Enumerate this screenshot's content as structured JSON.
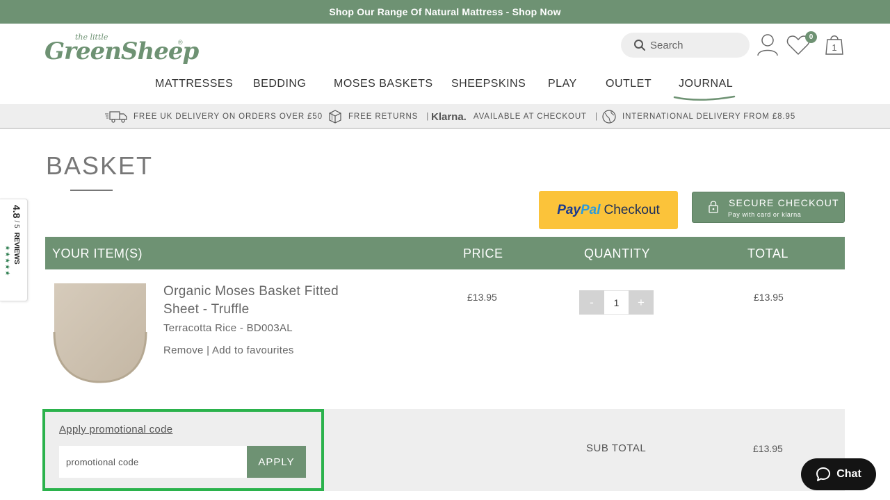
{
  "banner": {
    "text": "Shop Our Range Of Natural Mattress - Shop Now"
  },
  "logo": {
    "small": "the little",
    "big": "GreenSheep",
    "reg": "®"
  },
  "header": {
    "search_placeholder": "Search",
    "wishlist_count": "0",
    "basket_count": "1"
  },
  "nav": {
    "items": [
      {
        "label": "MATTRESSES"
      },
      {
        "label": "BEDDING"
      },
      {
        "label": "MOSES BASKETS"
      },
      {
        "label": "SHEEPSKINS"
      },
      {
        "label": "PLAY"
      },
      {
        "label": "OUTLET"
      },
      {
        "label": "JOURNAL"
      }
    ],
    "active": "JOURNAL"
  },
  "usp": {
    "delivery": "FREE UK DELIVERY ON ORDERS OVER £50",
    "returns": "FREE RETURNS",
    "klarna_logo": "Klarna.",
    "klarna": "AVAILABLE AT CHECKOUT",
    "international": "INTERNATIONAL DELIVERY FROM £8.95",
    "separator": "|"
  },
  "page": {
    "title": "BASKET"
  },
  "checkout": {
    "paypal_part1": "Pay",
    "paypal_part2": "Pal",
    "paypal_part3": "Checkout",
    "secure_label": "SECURE CHECKOUT",
    "secure_sub": "Pay with card or klarna"
  },
  "table": {
    "headers": {
      "items": "YOUR ITEM(S)",
      "price": "PRICE",
      "quantity": "QUANTITY",
      "total": "TOTAL"
    }
  },
  "item": {
    "name": "Organic Moses Basket Fitted Sheet - Truffle",
    "variant": "Terracotta Rice - BD003AL",
    "remove": "Remove",
    "links_sep": "|",
    "favourite": "Add to favourites",
    "price": "£13.95",
    "quantity": "1",
    "qty_minus": "-",
    "qty_plus": "+",
    "total": "£13.95"
  },
  "promo": {
    "link": "Apply promotional code",
    "placeholder": "promotional code",
    "apply": "APPLY"
  },
  "summary": {
    "subtotal_label": "SUB TOTAL",
    "subtotal_value": "£13.95"
  },
  "reviews": {
    "score": "4.8",
    "out_of": "/ 5",
    "brand": "REVIEWS",
    "stars": "★★★★★"
  },
  "chat": {
    "label": "Chat"
  },
  "colors": {
    "brand_green": "#6e9273",
    "highlight_green": "#2bb24c",
    "paypal_yellow": "#fbc33a"
  }
}
